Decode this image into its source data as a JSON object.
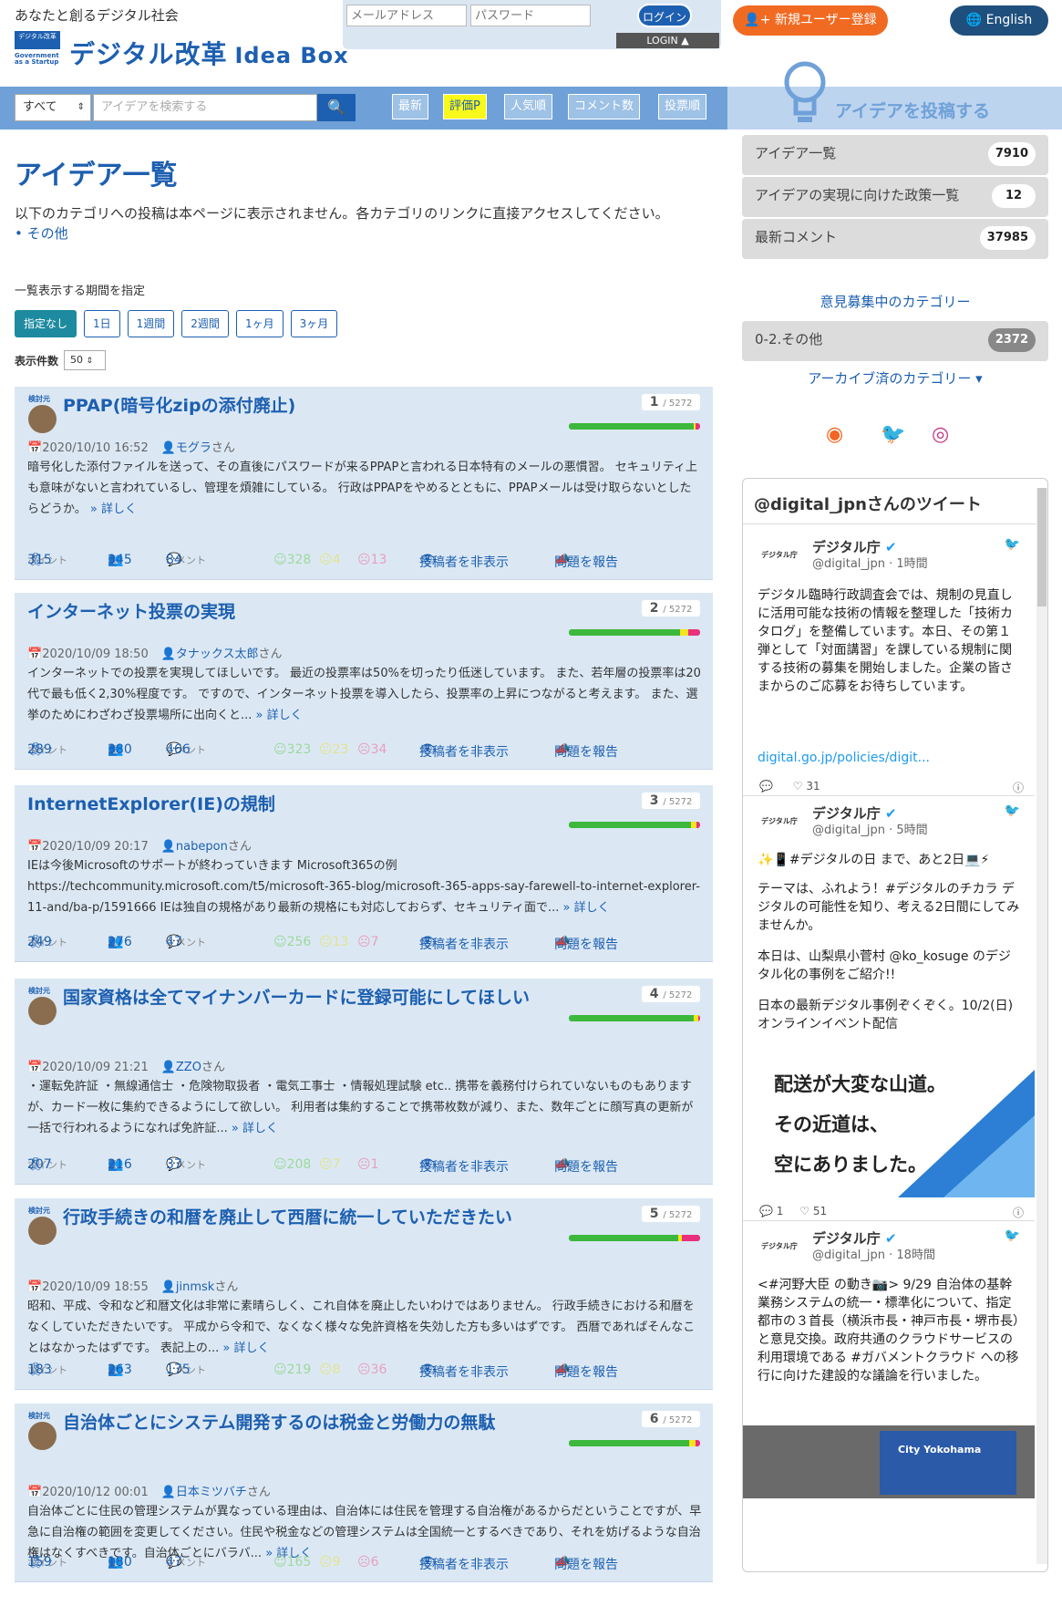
{
  "header": {
    "tagline": "あなたと創るデジタル社会",
    "logo_top": "デジタル改革",
    "logo_bottom": "Government as a Startup",
    "brand": "デジタル改革",
    "brand_sub": "Idea Box",
    "email_placeholder": "メールアドレス",
    "password_placeholder": "パスワード",
    "login_label": "ログイン",
    "login_tab": "LOGIN ▲",
    "register_label": "新規ユーザー登録",
    "english_label": "English"
  },
  "navbar": {
    "category_select": "すべて",
    "search_placeholder": "アイデアを検索する",
    "sort": [
      "最新",
      "評価P",
      "人気順",
      "コメント数",
      "投票順"
    ],
    "post_banner": "アイデアを投稿する"
  },
  "main": {
    "title": "アイデア一覧",
    "note": "以下のカテゴリへの投稿は本ページに表示されません。各カテゴリのリンクに直接アクセスしてください。",
    "note_link": "その他",
    "period_label": "一覧表示する期間を指定",
    "periods": [
      "指定なし",
      "1日",
      "1週間",
      "2週間",
      "1ヶ月",
      "3ヶ月"
    ],
    "count_label": "表示件数",
    "count_value": "50"
  },
  "ideas": [
    {
      "title": "PPAP(暗号化zipの添付廃止)",
      "kento": "検討元",
      "rank": "1",
      "total": "/ 5272",
      "date": "2020/10/10 16:52",
      "user": "モグラ",
      "san": "さん",
      "body": "暗号化した添付ファイルを送って、その直後にパスワードが来るPPAPと言われる日本特有のメールの悪慣習。 セキュリティ上も意味がないと言われているし、管理を煩雑にしている。 行政はPPAPをやめるとともに、PPAPメールは受け取らないとしたらどうか。",
      "more": "» 詳しく",
      "points": "315",
      "votes": "345",
      "comments": "84",
      "good": "328",
      "neutral": "4",
      "bad": "13"
    },
    {
      "title": "インターネット投票の実現",
      "kento": "",
      "rank": "2",
      "total": "/ 5272",
      "date": "2020/10/09 18:50",
      "user": "タナックス太郎",
      "san": "さん",
      "body": "インターネットでの投票を実現してほしいです。 最近の投票率は50%を切ったり低迷しています。 また、若年層の投票率は20代で最も低く2,30%程度です。 ですので、インターネット投票を導入したら、投票率の上昇につながると考えます。 また、選挙のためにわざわざ投票場所に出向くと...",
      "more": "» 詳しく",
      "points": "289",
      "votes": "380",
      "comments": "466",
      "good": "323",
      "neutral": "23",
      "bad": "34"
    },
    {
      "title": "InternetExplorer(IE)の規制",
      "kento": "",
      "rank": "3",
      "total": "/ 5272",
      "date": "2020/10/09 20:17",
      "user": "nabepon",
      "san": "さん",
      "body": "IEは今後Microsoftのサポートが終わっていきます Microsoft365の例 https://techcommunity.microsoft.com/t5/microsoft-365-blog/microsoft-365-apps-say-farewell-to-internet-explorer-11-and/ba-p/1591666 IEは独自の規格があり最新の規格にも対応しておらず、セキュリティ面で...",
      "more": "» 詳しく",
      "points": "249",
      "votes": "276",
      "comments": "47",
      "good": "256",
      "neutral": "13",
      "bad": "7"
    },
    {
      "title": "国家資格は全てマイナンバーカードに登録可能にしてほしい",
      "kento": "検討元",
      "rank": "4",
      "total": "/ 5272",
      "date": "2020/10/09 21:21",
      "user": "ZZO",
      "san": "さん",
      "body": "・運転免許証 ・無線通信士 ・危険物取扱者 ・電気工事士 ・情報処理試験 etc.. 携帯を義務付けられていないものもありますが、カード一枚に集約できるようにして欲しい。 利用者は集約することで携帯枚数が減り、また、数年ごとに顔写真の更新が一括で行われるようになれば免許証...",
      "more": "» 詳しく",
      "points": "207",
      "votes": "216",
      "comments": "37",
      "good": "208",
      "neutral": "7",
      "bad": "1"
    },
    {
      "title": "行政手続きの和暦を廃止して西暦に統一していただきたい",
      "kento": "検討元",
      "rank": "5",
      "total": "/ 5272",
      "date": "2020/10/09 18:55",
      "user": "jinmsk",
      "san": "さん",
      "body": "昭和、平成、令和など和暦文化は非常に素晴らしく、これ自体を廃止したいわけではありません。 行政手続きにおける和暦をなくしていただきたいです。 平成から令和で、なくなく様々な免許資格を失効した方も多いはずです。 西暦であればそんなことはなかったはずです。 表記上の...",
      "more": "» 詳しく",
      "points": "183",
      "votes": "263",
      "comments": "175",
      "good": "219",
      "neutral": "8",
      "bad": "36"
    },
    {
      "title": "自治体ごとにシステム開発するのは税金と労働力の無駄",
      "kento": "検討元",
      "rank": "6",
      "total": "/ 5272",
      "date": "2020/10/12 00:01",
      "user": "日本ミツバチ",
      "san": "さん",
      "body": "自治体ごとに住民の管理システムが異なっている理由は、自治体には住民を管理する自治権があるからだということですが、早急に自治権の範囲を変更してください。住民や税金などの管理システムは全国統一とするべきであり、それを妨げるような自治権はなくすべきです。自治体ごとにバラバ...",
      "more": "» 詳しく",
      "points": "159",
      "votes": "180",
      "comments": "47",
      "good": "165",
      "neutral": "9",
      "bad": "6"
    }
  ],
  "card_labels": {
    "points": "ポイント",
    "votes": "票",
    "comments": "コメント",
    "hide": "投稿者を非表示",
    "report": "問題を報告"
  },
  "sidebar": {
    "items": [
      {
        "label": "アイデア一覧",
        "count": "7910"
      },
      {
        "label": "アイデアの実現に向けた政策一覧",
        "count": "12"
      },
      {
        "label": "最新コメント",
        "count": "37985"
      }
    ],
    "open_categories": "意見募集中のカテゴリー",
    "other_cat": {
      "label": "0-2.その他",
      "count": "2372"
    },
    "archived": "アーカイブ済のカテゴリー ▾"
  },
  "twitter": {
    "header": "@digital_jpnさんのツイート",
    "tweets": [
      {
        "name": "デジタル庁",
        "handle": "@digital_jpn · 1時間",
        "logo": "デジタル庁",
        "text": "デジタル臨時行政調査会では、規制の見直しに活用可能な技術の情報を整理した「技術カタログ」を整備しています。本日、その第１弾として「対面講習」を課している規制に関する技術の募集を開始しました。企業の皆さまからのご応募をお待ちしています。",
        "link": "digital.go.jp/policies/digit...",
        "likes": "31"
      },
      {
        "name": "デジタル庁",
        "handle": "@digital_jpn · 5時間",
        "logo": "デジタル庁",
        "text1": "✨📱#デジタルの日 まで、あと2日💻⚡",
        "text2": "テーマは、ふれよう！#デジタルのチカラ デジタルの可能性を知り、考える2日間にしてみませんか。",
        "text3": "本日は、山梨県小菅村 @ko_kosuge のデジタル化の事例をご紹介!!",
        "text4": "日本の最新デジタル事例ぞくぞく。10/2(日)オンラインイベント配信",
        "img_text": [
          "配送が大変な山道。",
          "その近道は、",
          "空にありました。"
        ],
        "replies": "1",
        "likes": "51"
      },
      {
        "name": "デジタル庁",
        "handle": "@digital_jpn · 18時間",
        "logo": "デジタル庁",
        "text": "<#河野大臣 の動き📷> 9/29 自治体の基幹業務システムの統一・標準化について、指定都市の３首長（横浜市長・神戸市長・堺市長）と意見交換。政府共通のクラウドサービスの利用環境である #ガバメントクラウド への移行に向けた建設的な議論を行いました。",
        "img_label": "City Yokohama"
      }
    ]
  },
  "colors": {
    "primary": "#1d5fb0",
    "accent": "#f16a22",
    "card_bg": "#dbe8f4"
  }
}
